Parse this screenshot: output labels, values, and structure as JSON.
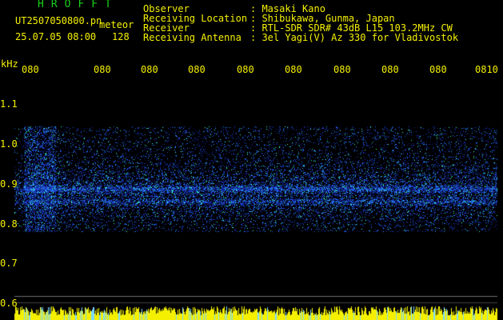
{
  "header": {
    "brand": "HROFFT",
    "filename": "UT2507050800.pn",
    "mode": "meteor",
    "datetime": "25.07.05 08:00",
    "count": "128",
    "fields": [
      {
        "label": "Observer",
        "value": ": Masaki Kano"
      },
      {
        "label": "Receiving Location",
        "value": ": Shibukawa, Gunma, Japan"
      },
      {
        "label": "Receiver",
        "value": ": RTL-SDR SDR# 43dB L15 103.2MHz CW"
      },
      {
        "label": "Receiving Antenna",
        "value": ": 3el Yagi(V) Az 330 for Vladivostok"
      }
    ]
  },
  "axes": {
    "unit": "kHz",
    "x_ticks": [
      "080",
      "080",
      "080",
      "080",
      "080",
      "080",
      "080",
      "080",
      "080",
      "0810"
    ],
    "y_ticks": [
      "1.1",
      "1.0",
      "0.9",
      "0.8",
      "0.7",
      "0.6"
    ]
  },
  "colors": {
    "background": "#000000",
    "text": "#f4f000",
    "brand": "#19d219",
    "signal_low": "#1a2aa0",
    "signal_mid": "#2a8cff",
    "signal_high": "#3dffd0",
    "level_bar": "#f4f000",
    "reference_line": "#c8c8c8"
  }
}
